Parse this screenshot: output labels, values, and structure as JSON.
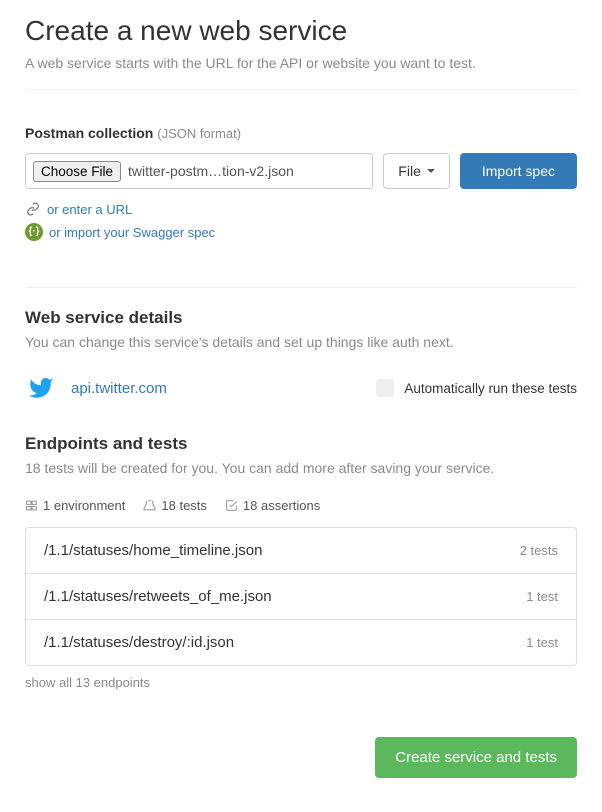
{
  "header": {
    "title": "Create a new web service",
    "subtitle": "A web service starts with the URL for the API or website you want to test."
  },
  "postman": {
    "label": "Postman collection",
    "hint": "(JSON format)",
    "choose_file": "Choose File",
    "filename": "twitter-postm…tion-v2.json",
    "type_label": "File",
    "import_label": "Import spec",
    "url_link": "or enter a URL",
    "swagger_link": "or import your Swagger spec"
  },
  "details": {
    "title": "Web service details",
    "desc": "You can change this service's details and set up things like auth next.",
    "service_url": "api.twitter.com",
    "auto_run_label": "Automatically run these tests"
  },
  "endpoints": {
    "title": "Endpoints and tests",
    "desc": "18 tests will be created for you. You can add more after saving your service.",
    "stats": {
      "env": "1 environment",
      "tests": "18 tests",
      "assertions": "18 assertions"
    },
    "items": [
      {
        "path": "/1.1/statuses/home_timeline.json",
        "count": "2 tests"
      },
      {
        "path": "/1.1/statuses/retweets_of_me.json",
        "count": "1 test"
      },
      {
        "path": "/1.1/statuses/destroy/:id.json",
        "count": "1 test"
      }
    ],
    "show_all": "show all 13 endpoints"
  },
  "footer": {
    "create_label": "Create service and tests"
  }
}
